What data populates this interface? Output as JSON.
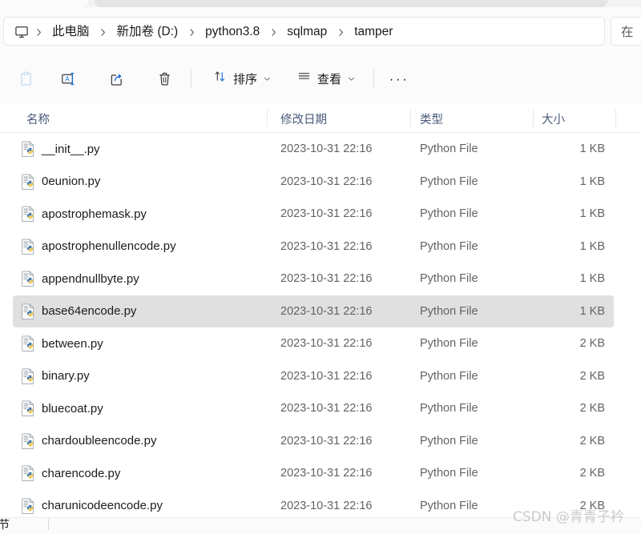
{
  "window": {
    "tabstrip_present": true
  },
  "address_bar": {
    "pc_icon": "computer-monitor-icon",
    "separator_icon": "chevron-right-icon",
    "breadcrumbs": [
      {
        "label": "此电脑"
      },
      {
        "label": "新加卷 (D:)"
      },
      {
        "label": "python3.8"
      },
      {
        "label": "sqlmap"
      },
      {
        "label": "tamper"
      }
    ],
    "search": {
      "visible_text": "在",
      "placeholder": "在 tamper 中搜索"
    }
  },
  "toolbar": {
    "items": [
      {
        "name": "paste-button",
        "icon": "clipboard-paste-icon",
        "label": "",
        "disabled": true
      },
      {
        "name": "rename-button",
        "icon": "rename-icon",
        "label": "",
        "disabled": false
      },
      {
        "name": "share-button",
        "icon": "share-icon",
        "label": "",
        "disabled": false
      },
      {
        "name": "delete-button",
        "icon": "trash-icon",
        "label": "",
        "disabled": false
      }
    ],
    "sort_label": "排序",
    "view_label": "查看",
    "more_label": "···",
    "sort_icon": "sort-arrows-icon",
    "view_icon": "list-lines-icon",
    "caret_icon": "chevron-down-icon",
    "more_icon": "ellipsis-icon"
  },
  "file_list": {
    "sort_indicator": "sort-ascending-chevron",
    "columns": [
      {
        "key": "name",
        "label": "名称"
      },
      {
        "key": "date",
        "label": "修改日期"
      },
      {
        "key": "type",
        "label": "类型"
      },
      {
        "key": "size",
        "label": "大小"
      }
    ],
    "rows": [
      {
        "name": "__init__.py",
        "date": "2023-10-31 22:16",
        "type": "Python File",
        "size": "1 KB",
        "icon": "python-file-icon",
        "selected": false
      },
      {
        "name": "0eunion.py",
        "date": "2023-10-31 22:16",
        "type": "Python File",
        "size": "1 KB",
        "icon": "python-file-icon",
        "selected": false
      },
      {
        "name": "apostrophemask.py",
        "date": "2023-10-31 22:16",
        "type": "Python File",
        "size": "1 KB",
        "icon": "python-file-icon",
        "selected": false
      },
      {
        "name": "apostrophenullencode.py",
        "date": "2023-10-31 22:16",
        "type": "Python File",
        "size": "1 KB",
        "icon": "python-file-icon",
        "selected": false
      },
      {
        "name": "appendnullbyte.py",
        "date": "2023-10-31 22:16",
        "type": "Python File",
        "size": "1 KB",
        "icon": "python-file-icon",
        "selected": false
      },
      {
        "name": "base64encode.py",
        "date": "2023-10-31 22:16",
        "type": "Python File",
        "size": "1 KB",
        "icon": "python-file-icon",
        "selected": true
      },
      {
        "name": "between.py",
        "date": "2023-10-31 22:16",
        "type": "Python File",
        "size": "2 KB",
        "icon": "python-file-icon",
        "selected": false
      },
      {
        "name": "binary.py",
        "date": "2023-10-31 22:16",
        "type": "Python File",
        "size": "2 KB",
        "icon": "python-file-icon",
        "selected": false
      },
      {
        "name": "bluecoat.py",
        "date": "2023-10-31 22:16",
        "type": "Python File",
        "size": "2 KB",
        "icon": "python-file-icon",
        "selected": false
      },
      {
        "name": "chardoubleencode.py",
        "date": "2023-10-31 22:16",
        "type": "Python File",
        "size": "2 KB",
        "icon": "python-file-icon",
        "selected": false
      },
      {
        "name": "charencode.py",
        "date": "2023-10-31 22:16",
        "type": "Python File",
        "size": "2 KB",
        "icon": "python-file-icon",
        "selected": false
      },
      {
        "name": "charunicodeencode.py",
        "date": "2023-10-31 22:16",
        "type": "Python File",
        "size": "2 KB",
        "icon": "python-file-icon",
        "selected": false
      }
    ]
  },
  "status_bar": {
    "text": "字节"
  },
  "watermark": {
    "text": "CSDN @青青子衿"
  },
  "colors": {
    "selection": "#e0e0e0",
    "header_text": "#4a5a7a",
    "body_text": "#1b1b1b",
    "muted_text": "#636363",
    "accent_blue": "#1a6fd4",
    "python_yellow": "#ffd43b",
    "window_bg": "#fbfbfb"
  }
}
